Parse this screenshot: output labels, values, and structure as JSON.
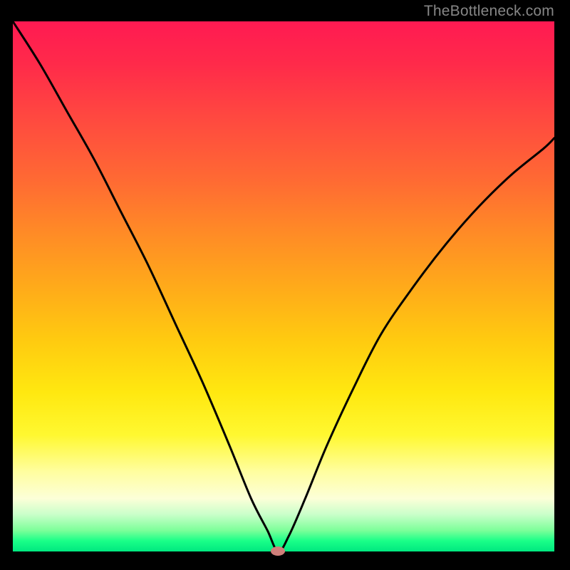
{
  "watermark": "TheBottleneck.com",
  "colors": {
    "curve": "#000000",
    "marker": "#cf7f7a",
    "background_frame": "#000000"
  },
  "chart_data": {
    "type": "line",
    "title": "",
    "xlabel": "",
    "ylabel": "",
    "xlim": [
      0,
      100
    ],
    "ylim": [
      0,
      100
    ],
    "min_point": {
      "x": 49,
      "y": 0
    },
    "series": [
      {
        "name": "bottleneck-curve",
        "x": [
          0,
          5,
          10,
          15,
          20,
          25,
          30,
          35,
          40,
          44,
          47,
          49,
          51,
          54,
          58,
          63,
          68,
          74,
          80,
          86,
          92,
          98,
          100
        ],
        "values": [
          100,
          92,
          83,
          74,
          64,
          54,
          43,
          32,
          20,
          10,
          4,
          0,
          3,
          10,
          20,
          31,
          41,
          50,
          58,
          65,
          71,
          76,
          78
        ]
      }
    ],
    "annotations": [
      {
        "type": "marker",
        "shape": "ellipse",
        "x": 49,
        "y": 0,
        "color": "#cf7f7a"
      }
    ],
    "gradient_bands": [
      {
        "y": 100,
        "color": "#ff1a52"
      },
      {
        "y": 50,
        "color": "#ffaa1a"
      },
      {
        "y": 20,
        "color": "#fff830"
      },
      {
        "y": 5,
        "color": "#7dff9a"
      },
      {
        "y": 0,
        "color": "#00e880"
      }
    ]
  }
}
